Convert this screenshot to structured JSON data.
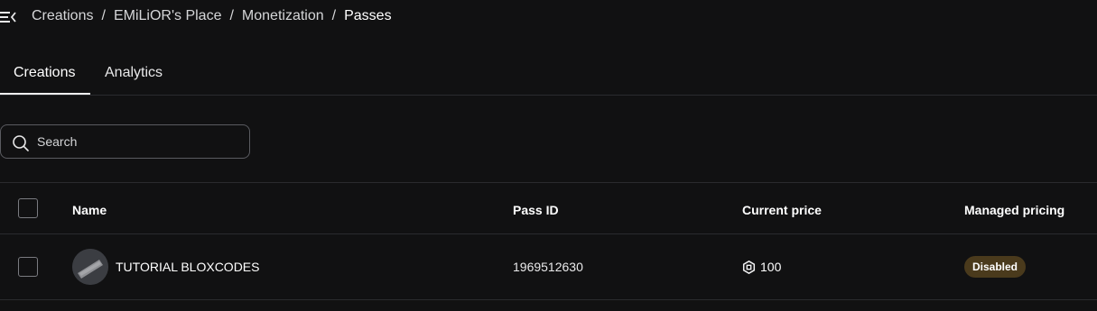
{
  "breadcrumb": {
    "items": [
      "Creations",
      "EMiLiOR's Place",
      "Monetization",
      "Passes"
    ],
    "separator": "/"
  },
  "tabs": [
    {
      "label": "Creations",
      "active": true
    },
    {
      "label": "Analytics",
      "active": false
    }
  ],
  "search": {
    "placeholder": "Search",
    "value": ""
  },
  "table": {
    "columns": [
      "Name",
      "Pass ID",
      "Current price",
      "Managed pricing"
    ],
    "rows": [
      {
        "name": "TUTORIAL BLOXCODES",
        "pass_id": "1969512630",
        "price": "100",
        "managed_pricing": "Disabled"
      }
    ]
  },
  "icons": {
    "menu": "menu-collapse-icon",
    "search": "search-icon",
    "currency": "robux-icon"
  },
  "colors": {
    "background": "#111112",
    "badge_disabled": "#4a3a1c"
  }
}
